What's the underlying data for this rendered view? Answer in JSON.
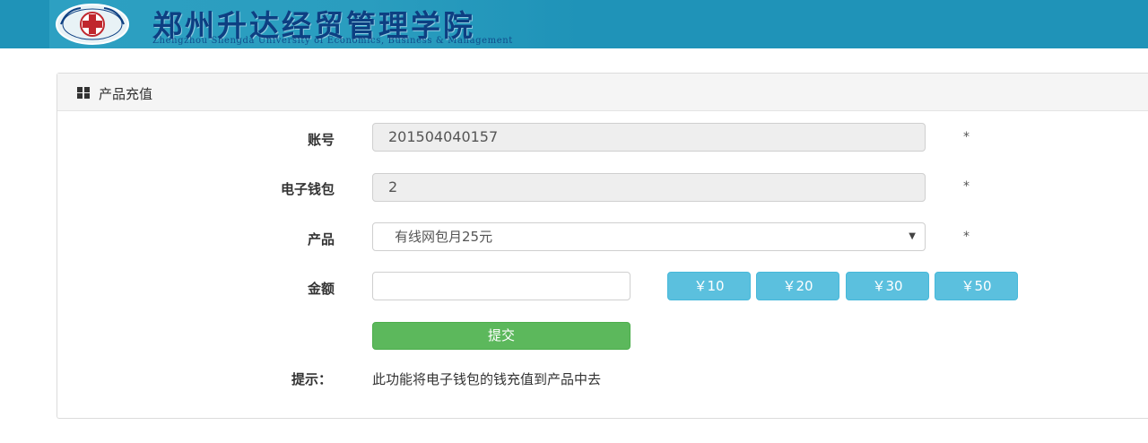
{
  "header": {
    "school_name": "郑州升达经贸管理学院",
    "school_name_en": "Zhengzhou Shengda University of Economics, Business & Management"
  },
  "panel": {
    "title": "产品充值"
  },
  "form": {
    "account_label": "账号",
    "account_value": "201504040157",
    "wallet_label": "电子钱包",
    "wallet_value": "2",
    "product_label": "产品",
    "product_value": "有线网包月25元",
    "amount_label": "金额",
    "amount_value": "",
    "required_mark": "*",
    "amount_buttons": [
      "￥10",
      "￥20",
      "￥30",
      "￥50"
    ],
    "submit_label": "提交",
    "hint_label": "提示：",
    "hint_text": "此功能将电子钱包的钱充值到产品中去"
  },
  "colors": {
    "header_bg": "#1f93b8",
    "info_button": "#5bc0de",
    "success_button": "#5cb85c"
  }
}
